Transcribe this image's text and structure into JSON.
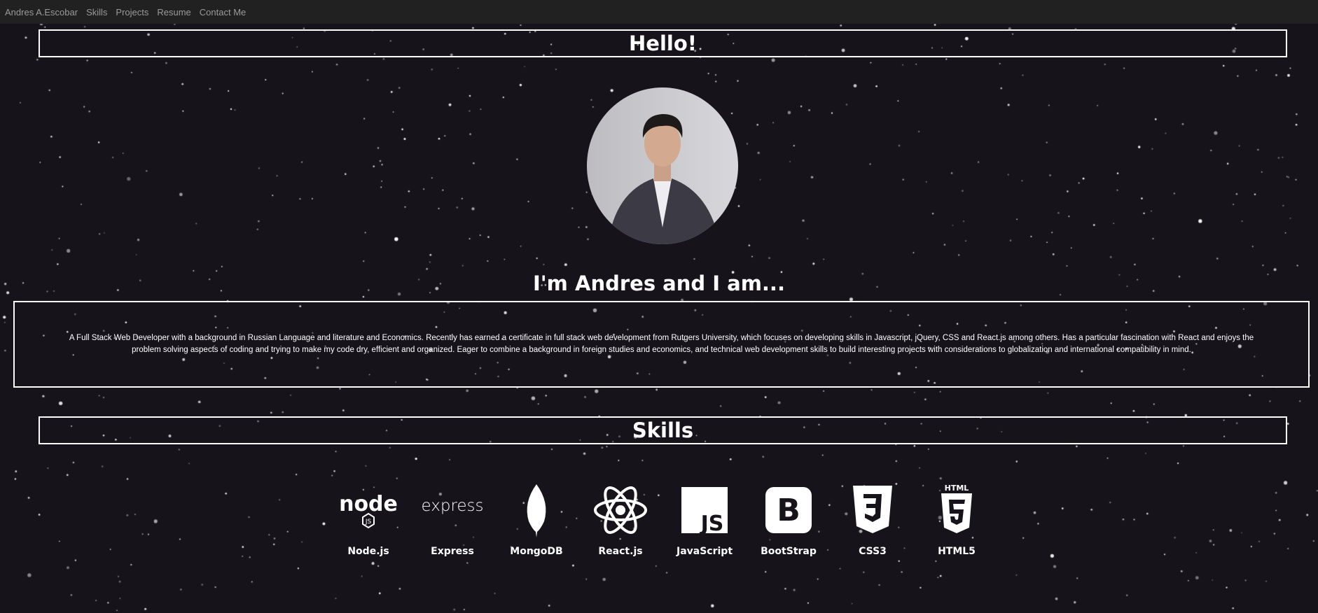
{
  "nav": {
    "brand": "Andres A.Escobar",
    "links": [
      "Skills",
      "Projects",
      "Resume",
      "Contact Me"
    ]
  },
  "hello": {
    "title": "Hello!"
  },
  "intro": {
    "heading": "I'm Andres and I am...",
    "bio": "A Full Stack Web Developer with a background in Russian Language and literature and Economics. Recently has earned a certificate in full stack web development from Rutgers University, which focuses on developing skills in Javascript, jQuery, CSS and React.js among others. Has a particular fascination with React and enjoys the problem solving aspects of coding and trying to make my code dry, efficient and organized. Eager to combine a background in foreign studies and economics, and technical web development skills to build interesting projects with considerations to globalization and international compatibility in mind."
  },
  "skills": {
    "title": "Skills",
    "items": [
      {
        "label": "Node.js",
        "icon": "nodejs-icon"
      },
      {
        "label": "Express",
        "icon": "express-icon"
      },
      {
        "label": "MongoDB",
        "icon": "mongodb-icon"
      },
      {
        "label": "React.js",
        "icon": "react-icon"
      },
      {
        "label": "JavaScript",
        "icon": "javascript-icon"
      },
      {
        "label": "BootStrap",
        "icon": "bootstrap-icon"
      },
      {
        "label": "CSS3",
        "icon": "css3-icon"
      },
      {
        "label": "HTML5",
        "icon": "html5-icon"
      }
    ]
  },
  "colors": {
    "background": "#16131b",
    "navbar": "#212121",
    "navlink": "#9a9a9a"
  }
}
